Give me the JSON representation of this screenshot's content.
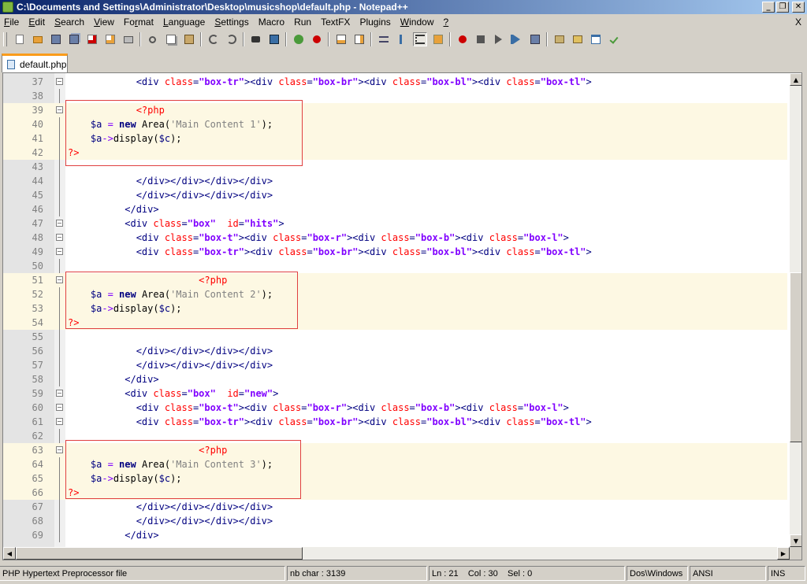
{
  "window": {
    "title": "C:\\Documents and Settings\\Administrator\\Desktop\\musicshop\\default.php - Notepad++"
  },
  "menu": {
    "items": [
      {
        "pre": "",
        "u": "F",
        "post": "ile"
      },
      {
        "pre": "",
        "u": "E",
        "post": "dit"
      },
      {
        "pre": "",
        "u": "S",
        "post": "earch"
      },
      {
        "pre": "",
        "u": "V",
        "post": "iew"
      },
      {
        "pre": "Fo",
        "u": "r",
        "post": "mat"
      },
      {
        "pre": "",
        "u": "L",
        "post": "anguage"
      },
      {
        "pre": "",
        "u": "S",
        "post": "ettings"
      },
      {
        "pre": "Macro",
        "u": "",
        "post": ""
      },
      {
        "pre": "Run",
        "u": "",
        "post": ""
      },
      {
        "pre": "TextFX",
        "u": "",
        "post": ""
      },
      {
        "pre": "Plugins",
        "u": "",
        "post": ""
      },
      {
        "pre": "",
        "u": "W",
        "post": "indow"
      },
      {
        "pre": "",
        "u": "?",
        "post": ""
      }
    ],
    "close": "X"
  },
  "toolbar": {
    "icons": [
      "new-file-icon",
      "open-file-icon",
      "save-icon",
      "save-all-icon",
      "close-icon",
      "close-all-icon",
      "print-icon",
      "|",
      "cut-icon",
      "copy-icon",
      "paste-icon",
      "|",
      "undo-icon",
      "redo-icon",
      "|",
      "find-icon",
      "replace-icon",
      "|",
      "zoom-in-icon",
      "zoom-out-icon",
      "|",
      "sync-vertical-icon",
      "sync-horizontal-icon",
      "|",
      "word-wrap-icon",
      "show-all-chars-icon",
      "indent-guide-icon",
      "user-lang-icon",
      "|",
      "record-macro-icon",
      "stop-record-icon",
      "playback-icon",
      "run-macro-multiple-icon",
      "save-macro-icon",
      "|",
      "folder-icon",
      "folder-open-icon",
      "window-icon",
      "spell-check-icon"
    ],
    "colors": {
      "accent_blue": "#3a6ea5",
      "record_red": "#cc0000",
      "orange": "#e8a13a",
      "green": "#4a9a3a"
    }
  },
  "tabs": [
    {
      "label": "default.php",
      "active": true
    }
  ],
  "editor": {
    "lines": [
      {
        "n": "37",
        "fold": true,
        "tokens": [
          [
            "t",
            "            "
          ],
          [
            "tag",
            "<div "
          ],
          [
            "attr",
            "class"
          ],
          [
            "tag",
            "="
          ],
          [
            "str",
            "\"box-tr\""
          ],
          [
            "tag",
            "><div "
          ],
          [
            "attr",
            "class"
          ],
          [
            "tag",
            "="
          ],
          [
            "str",
            "\"box-br\""
          ],
          [
            "tag",
            "><div "
          ],
          [
            "attr",
            "class"
          ],
          [
            "tag",
            "="
          ],
          [
            "str",
            "\"box-bl\""
          ],
          [
            "tag",
            "><div "
          ],
          [
            "attr",
            "class"
          ],
          [
            "tag",
            "="
          ],
          [
            "str",
            "\"box-tl\""
          ],
          [
            "tag",
            ">"
          ]
        ]
      },
      {
        "n": "38",
        "tokens": []
      },
      {
        "n": "39",
        "php": true,
        "fold": true,
        "tokens": [
          [
            "t",
            "            "
          ],
          [
            "phptag",
            "<?php"
          ]
        ]
      },
      {
        "n": "40",
        "php": true,
        "tokens": [
          [
            "t",
            "    "
          ],
          [
            "var",
            "$a "
          ],
          [
            "op",
            "= "
          ],
          [
            "kw",
            "new "
          ],
          [
            "fn",
            "Area("
          ],
          [
            "pstr",
            "'Main Content 1'"
          ],
          [
            "fn",
            ");"
          ]
        ]
      },
      {
        "n": "41",
        "php": true,
        "tokens": [
          [
            "t",
            "    "
          ],
          [
            "var",
            "$a"
          ],
          [
            "op",
            "->"
          ],
          [
            "fn",
            "display("
          ],
          [
            "var",
            "$c"
          ],
          [
            "fn",
            ");"
          ]
        ]
      },
      {
        "n": "42",
        "php": true,
        "tokens": [
          [
            "phptag",
            "?>"
          ]
        ]
      },
      {
        "n": "43",
        "tokens": []
      },
      {
        "n": "44",
        "tokens": [
          [
            "t",
            "            "
          ],
          [
            "tag",
            "</div></div></div></div>"
          ]
        ]
      },
      {
        "n": "45",
        "tokens": [
          [
            "t",
            "            "
          ],
          [
            "tag",
            "</div></div></div></div>"
          ]
        ]
      },
      {
        "n": "46",
        "tokens": [
          [
            "t",
            "          "
          ],
          [
            "tag",
            "</div>"
          ]
        ]
      },
      {
        "n": "47",
        "fold": true,
        "tokens": [
          [
            "t",
            "          "
          ],
          [
            "tag",
            "<div "
          ],
          [
            "attr",
            "class"
          ],
          [
            "tag",
            "="
          ],
          [
            "str",
            "\"box\""
          ],
          [
            "tag",
            "  "
          ],
          [
            "attr",
            "id"
          ],
          [
            "tag",
            "="
          ],
          [
            "str",
            "\"hits\""
          ],
          [
            "tag",
            ">"
          ]
        ]
      },
      {
        "n": "48",
        "fold": true,
        "tokens": [
          [
            "t",
            "            "
          ],
          [
            "tag",
            "<div "
          ],
          [
            "attr",
            "class"
          ],
          [
            "tag",
            "="
          ],
          [
            "str",
            "\"box-t\""
          ],
          [
            "tag",
            "><div "
          ],
          [
            "attr",
            "class"
          ],
          [
            "tag",
            "="
          ],
          [
            "str",
            "\"box-r\""
          ],
          [
            "tag",
            "><div "
          ],
          [
            "attr",
            "class"
          ],
          [
            "tag",
            "="
          ],
          [
            "str",
            "\"box-b\""
          ],
          [
            "tag",
            "><div "
          ],
          [
            "attr",
            "class"
          ],
          [
            "tag",
            "="
          ],
          [
            "str",
            "\"box-l\""
          ],
          [
            "tag",
            ">"
          ]
        ]
      },
      {
        "n": "49",
        "fold": true,
        "tokens": [
          [
            "t",
            "            "
          ],
          [
            "tag",
            "<div "
          ],
          [
            "attr",
            "class"
          ],
          [
            "tag",
            "="
          ],
          [
            "str",
            "\"box-tr\""
          ],
          [
            "tag",
            "><div "
          ],
          [
            "attr",
            "class"
          ],
          [
            "tag",
            "="
          ],
          [
            "str",
            "\"box-br\""
          ],
          [
            "tag",
            "><div "
          ],
          [
            "attr",
            "class"
          ],
          [
            "tag",
            "="
          ],
          [
            "str",
            "\"box-bl\""
          ],
          [
            "tag",
            "><div "
          ],
          [
            "attr",
            "class"
          ],
          [
            "tag",
            "="
          ],
          [
            "str",
            "\"box-tl\""
          ],
          [
            "tag",
            ">"
          ]
        ]
      },
      {
        "n": "50",
        "tokens": []
      },
      {
        "n": "51",
        "php": true,
        "fold": true,
        "tokens": [
          [
            "t",
            "                       "
          ],
          [
            "phptag",
            "<?php"
          ]
        ]
      },
      {
        "n": "52",
        "php": true,
        "tokens": [
          [
            "t",
            "    "
          ],
          [
            "var",
            "$a "
          ],
          [
            "op",
            "= "
          ],
          [
            "kw",
            "new "
          ],
          [
            "fn",
            "Area("
          ],
          [
            "pstr",
            "'Main Content 2'"
          ],
          [
            "fn",
            ");"
          ]
        ]
      },
      {
        "n": "53",
        "php": true,
        "tokens": [
          [
            "t",
            "    "
          ],
          [
            "var",
            "$a"
          ],
          [
            "op",
            "->"
          ],
          [
            "fn",
            "display("
          ],
          [
            "var",
            "$c"
          ],
          [
            "fn",
            ");"
          ]
        ]
      },
      {
        "n": "54",
        "php": true,
        "tokens": [
          [
            "phptag",
            "?>"
          ]
        ]
      },
      {
        "n": "55",
        "tokens": []
      },
      {
        "n": "56",
        "tokens": [
          [
            "t",
            "            "
          ],
          [
            "tag",
            "</div></div></div></div>"
          ]
        ]
      },
      {
        "n": "57",
        "tokens": [
          [
            "t",
            "            "
          ],
          [
            "tag",
            "</div></div></div></div>"
          ]
        ]
      },
      {
        "n": "58",
        "tokens": [
          [
            "t",
            "          "
          ],
          [
            "tag",
            "</div>"
          ]
        ]
      },
      {
        "n": "59",
        "fold": true,
        "tokens": [
          [
            "t",
            "          "
          ],
          [
            "tag",
            "<div "
          ],
          [
            "attr",
            "class"
          ],
          [
            "tag",
            "="
          ],
          [
            "str",
            "\"box\""
          ],
          [
            "tag",
            "  "
          ],
          [
            "attr",
            "id"
          ],
          [
            "tag",
            "="
          ],
          [
            "str",
            "\"new\""
          ],
          [
            "tag",
            ">"
          ]
        ]
      },
      {
        "n": "60",
        "fold": true,
        "tokens": [
          [
            "t",
            "            "
          ],
          [
            "tag",
            "<div "
          ],
          [
            "attr",
            "class"
          ],
          [
            "tag",
            "="
          ],
          [
            "str",
            "\"box-t\""
          ],
          [
            "tag",
            "><div "
          ],
          [
            "attr",
            "class"
          ],
          [
            "tag",
            "="
          ],
          [
            "str",
            "\"box-r\""
          ],
          [
            "tag",
            "><div "
          ],
          [
            "attr",
            "class"
          ],
          [
            "tag",
            "="
          ],
          [
            "str",
            "\"box-b\""
          ],
          [
            "tag",
            "><div "
          ],
          [
            "attr",
            "class"
          ],
          [
            "tag",
            "="
          ],
          [
            "str",
            "\"box-l\""
          ],
          [
            "tag",
            ">"
          ]
        ]
      },
      {
        "n": "61",
        "fold": true,
        "tokens": [
          [
            "t",
            "            "
          ],
          [
            "tag",
            "<div "
          ],
          [
            "attr",
            "class"
          ],
          [
            "tag",
            "="
          ],
          [
            "str",
            "\"box-tr\""
          ],
          [
            "tag",
            "><div "
          ],
          [
            "attr",
            "class"
          ],
          [
            "tag",
            "="
          ],
          [
            "str",
            "\"box-br\""
          ],
          [
            "tag",
            "><div "
          ],
          [
            "attr",
            "class"
          ],
          [
            "tag",
            "="
          ],
          [
            "str",
            "\"box-bl\""
          ],
          [
            "tag",
            "><div "
          ],
          [
            "attr",
            "class"
          ],
          [
            "tag",
            "="
          ],
          [
            "str",
            "\"box-tl\""
          ],
          [
            "tag",
            ">"
          ]
        ]
      },
      {
        "n": "62",
        "tokens": []
      },
      {
        "n": "63",
        "php": true,
        "fold": true,
        "tokens": [
          [
            "t",
            "                       "
          ],
          [
            "phptag",
            "<?php"
          ]
        ]
      },
      {
        "n": "64",
        "php": true,
        "tokens": [
          [
            "t",
            "    "
          ],
          [
            "var",
            "$a "
          ],
          [
            "op",
            "= "
          ],
          [
            "kw",
            "new "
          ],
          [
            "fn",
            "Area("
          ],
          [
            "pstr",
            "'Main Content 3'"
          ],
          [
            "fn",
            ");"
          ]
        ]
      },
      {
        "n": "65",
        "php": true,
        "tokens": [
          [
            "t",
            "    "
          ],
          [
            "var",
            "$a"
          ],
          [
            "op",
            "->"
          ],
          [
            "fn",
            "display("
          ],
          [
            "var",
            "$c"
          ],
          [
            "fn",
            ");"
          ]
        ]
      },
      {
        "n": "66",
        "php": true,
        "tokens": [
          [
            "phptag",
            "?>"
          ]
        ]
      },
      {
        "n": "67",
        "tokens": [
          [
            "t",
            "            "
          ],
          [
            "tag",
            "</div></div></div></div>"
          ]
        ]
      },
      {
        "n": "68",
        "tokens": [
          [
            "t",
            "            "
          ],
          [
            "tag",
            "</div></div></div></div>"
          ]
        ]
      },
      {
        "n": "69",
        "tokens": [
          [
            "t",
            "          "
          ],
          [
            "tag",
            "</div>"
          ]
        ]
      }
    ],
    "highlight_color": "#e04040"
  },
  "status": {
    "file_type": "PHP Hypertext Preprocessor file",
    "nb_char": "nb char : 3139",
    "position": "Ln : 21    Col : 30    Sel : 0",
    "eol": "Dos\\Windows",
    "encoding": "ANSI",
    "mode": "INS"
  }
}
